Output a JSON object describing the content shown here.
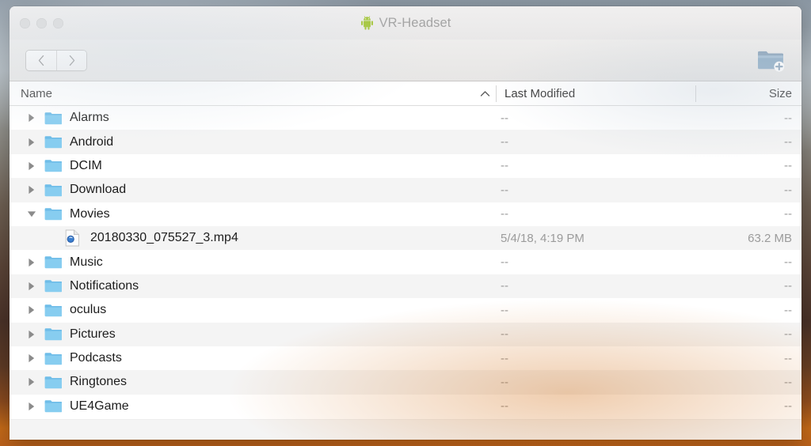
{
  "window": {
    "title": "VR-Headset",
    "title_icon": "android-robot-icon",
    "traffic_lights": [
      {
        "name": "close-button",
        "label": "Close"
      },
      {
        "name": "minimize-button",
        "label": "Minimize"
      },
      {
        "name": "zoom-button",
        "label": "Zoom"
      }
    ]
  },
  "toolbar": {
    "back_label": "Back",
    "forward_label": "Forward",
    "new_folder_label": "New Folder"
  },
  "columns": {
    "name": "Name",
    "last_modified": "Last Modified",
    "size": "Size",
    "sort_indicator": "^",
    "sort_column": "Name",
    "sort_direction": "ascending"
  },
  "colors": {
    "folder_blue": "#7ec8f0",
    "row_stripe": "#f4f4f4",
    "meta_text": "#9b9b9b",
    "android_green": "#a4c639"
  },
  "rows": [
    {
      "name": "Alarms",
      "kind": "folder",
      "expanded": false,
      "indent": 0,
      "modified": "--",
      "size": "--"
    },
    {
      "name": "Android",
      "kind": "folder",
      "expanded": false,
      "indent": 0,
      "modified": "--",
      "size": "--"
    },
    {
      "name": "DCIM",
      "kind": "folder",
      "expanded": false,
      "indent": 0,
      "modified": "--",
      "size": "--"
    },
    {
      "name": "Download",
      "kind": "folder",
      "expanded": false,
      "indent": 0,
      "modified": "--",
      "size": "--"
    },
    {
      "name": "Movies",
      "kind": "folder",
      "expanded": true,
      "indent": 0,
      "modified": "--",
      "size": "--"
    },
    {
      "name": "20180330_075527_3.mp4",
      "kind": "file",
      "expanded": false,
      "indent": 1,
      "modified": "5/4/18, 4:19 PM",
      "size": "63.2 MB"
    },
    {
      "name": "Music",
      "kind": "folder",
      "expanded": false,
      "indent": 0,
      "modified": "--",
      "size": "--"
    },
    {
      "name": "Notifications",
      "kind": "folder",
      "expanded": false,
      "indent": 0,
      "modified": "--",
      "size": "--"
    },
    {
      "name": "oculus",
      "kind": "folder",
      "expanded": false,
      "indent": 0,
      "modified": "--",
      "size": "--"
    },
    {
      "name": "Pictures",
      "kind": "folder",
      "expanded": false,
      "indent": 0,
      "modified": "--",
      "size": "--"
    },
    {
      "name": "Podcasts",
      "kind": "folder",
      "expanded": false,
      "indent": 0,
      "modified": "--",
      "size": "--"
    },
    {
      "name": "Ringtones",
      "kind": "folder",
      "expanded": false,
      "indent": 0,
      "modified": "--",
      "size": "--"
    },
    {
      "name": "UE4Game",
      "kind": "folder",
      "expanded": false,
      "indent": 0,
      "modified": "--",
      "size": "--"
    }
  ]
}
